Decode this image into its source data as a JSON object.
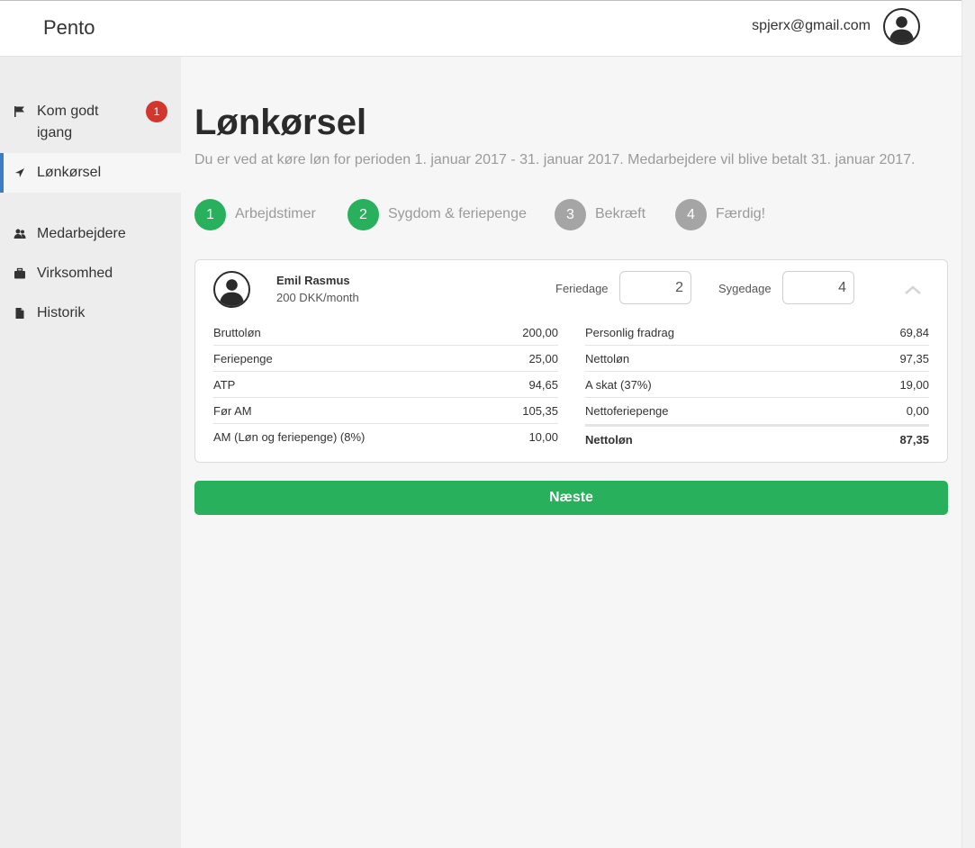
{
  "app": {
    "brand": "Pento"
  },
  "user": {
    "email": "spjerx@gmail.com",
    "avatar_icon": "user-avatar-icon"
  },
  "sidebar": {
    "items": [
      {
        "label_line1": "Kom godt",
        "label_line2": "igang",
        "icon": "flag-icon",
        "badge": "1"
      },
      {
        "label": "Lønkørsel",
        "icon": "send-icon"
      },
      {
        "label": "Medarbejdere",
        "icon": "users-icon"
      },
      {
        "label": "Virksomhed",
        "icon": "briefcase-icon"
      },
      {
        "label": "Historik",
        "icon": "document-icon"
      }
    ]
  },
  "page": {
    "title": "Lønkørsel",
    "subtitle": "Du er ved at køre løn for perioden 1. januar 2017 - 31. januar 2017. Medarbejdere vil blive betalt 31. januar 2017."
  },
  "steps": [
    {
      "number": "1",
      "label": "Arbejdstimer",
      "status": "done"
    },
    {
      "number": "2",
      "label": "Sygdom & feriepenge",
      "status": "done"
    },
    {
      "number": "3",
      "label": "Bekræft",
      "status": "todo"
    },
    {
      "number": "4",
      "label": "Færdig!",
      "status": "todo"
    }
  ],
  "employee": {
    "name": "Emil Rasmus",
    "salary": "200 DKK/month",
    "feriedage_label": "Feriedage",
    "feriedage_value": "2",
    "sygedage_label": "Sygedage",
    "sygedage_value": "4"
  },
  "payslip": {
    "left": [
      {
        "label": "Bruttoløn",
        "value": "200,00"
      },
      {
        "label": "Feriepenge",
        "value": "25,00"
      },
      {
        "label": "ATP",
        "value": "94,65"
      },
      {
        "label": "Før AM",
        "value": "105,35"
      },
      {
        "label": "AM (Løn og feriepenge) (8%)",
        "value": "10,00"
      }
    ],
    "right": [
      {
        "label": "Personlig fradrag",
        "value": "69,84"
      },
      {
        "label": "Nettoløn",
        "value": "97,35"
      },
      {
        "label": "A skat (37%)",
        "value": "19,00"
      },
      {
        "label": "Nettoferiepenge",
        "value": "0,00"
      }
    ],
    "total": {
      "label": "Nettoløn",
      "value": "87,35"
    }
  },
  "actions": {
    "next_label": "Næste"
  },
  "colors": {
    "accent_green": "#28b05c",
    "badge_red": "#d0382f",
    "active_nav": "#3a7fc4",
    "step_inactive": "#a5a5a5"
  }
}
